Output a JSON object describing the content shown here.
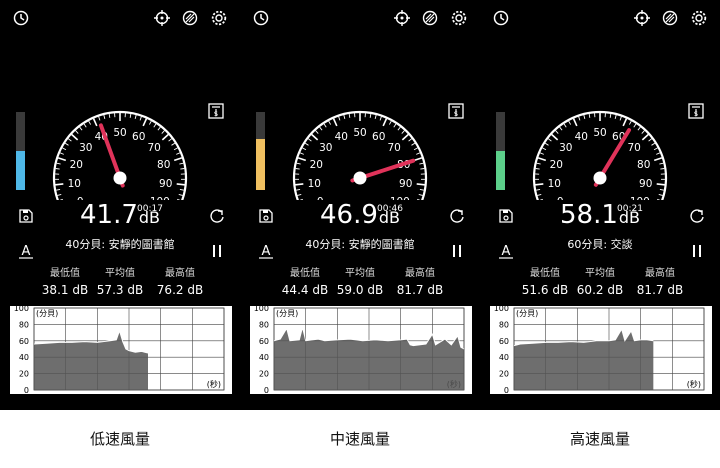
{
  "panels": [
    {
      "value": "41.7",
      "unit": "dB",
      "time": [
        "00",
        "17"
      ],
      "description": "40分貝: 安靜的圖書館",
      "stats": {
        "min_label": "最低值",
        "min": "38.1 dB",
        "avg_label": "平均值",
        "avg": "57.3 dB",
        "max_label": "最高值",
        "max": "76.2 dB"
      },
      "needle": 41.7,
      "level_fraction": 0.5,
      "level_color": "#4fb8e8",
      "caption": "低速風量",
      "chart_series": [
        [
          0,
          56
        ],
        [
          2,
          57
        ],
        [
          4,
          58
        ],
        [
          6,
          58
        ],
        [
          8,
          59
        ],
        [
          10,
          58
        ],
        [
          12,
          60
        ],
        [
          13,
          61
        ],
        [
          13.5,
          72
        ],
        [
          14,
          59
        ],
        [
          14.5,
          50
        ],
        [
          15,
          48
        ],
        [
          16,
          46
        ],
        [
          17,
          47
        ],
        [
          17.5,
          46
        ],
        [
          18,
          45
        ]
      ],
      "chart_end": 18
    },
    {
      "value": "46.9",
      "unit": "dB",
      "time": [
        "00",
        "46"
      ],
      "description": "40分貝: 安靜的圖書館",
      "stats": {
        "min_label": "最低值",
        "min": "44.4 dB",
        "avg_label": "平均值",
        "avg": "59.0 dB",
        "max_label": "最高值",
        "max": "81.7 dB"
      },
      "needle": 80,
      "level_fraction": 0.65,
      "level_color": "#f0c060",
      "caption": "中速風量",
      "chart_series": [
        [
          0,
          60
        ],
        [
          1,
          62
        ],
        [
          2,
          75
        ],
        [
          2.5,
          60
        ],
        [
          4,
          61
        ],
        [
          4.5,
          76
        ],
        [
          5,
          60
        ],
        [
          7,
          62
        ],
        [
          8,
          60
        ],
        [
          10,
          61
        ],
        [
          12,
          62
        ],
        [
          14,
          60
        ],
        [
          16,
          61
        ],
        [
          18,
          60
        ],
        [
          20,
          61
        ],
        [
          21,
          62
        ],
        [
          21.5,
          55
        ],
        [
          22,
          54
        ],
        [
          24,
          56
        ],
        [
          25,
          68
        ],
        [
          25.5,
          55
        ],
        [
          27,
          62
        ],
        [
          28,
          55
        ],
        [
          29,
          66
        ],
        [
          29.5,
          52
        ],
        [
          30,
          50
        ]
      ],
      "chart_end": 30
    },
    {
      "value": "58.1",
      "unit": "dB",
      "time": [
        "00",
        "21"
      ],
      "description": "60分貝: 交談",
      "stats": {
        "min_label": "最低值",
        "min": "51.6 dB",
        "avg_label": "平均值",
        "avg": "60.2 dB",
        "max_label": "最高值",
        "max": "81.7 dB"
      },
      "needle": 63,
      "level_fraction": 0.5,
      "level_color": "#5ccf8a",
      "caption": "高速風量",
      "chart_series": [
        [
          0,
          54
        ],
        [
          1,
          56
        ],
        [
          3,
          57
        ],
        [
          5,
          58
        ],
        [
          7,
          58
        ],
        [
          9,
          59
        ],
        [
          11,
          58
        ],
        [
          13,
          60
        ],
        [
          15,
          60
        ],
        [
          16,
          61
        ],
        [
          17,
          74
        ],
        [
          17.5,
          60
        ],
        [
          18.5,
          72
        ],
        [
          19,
          60
        ],
        [
          20,
          61
        ],
        [
          21,
          61
        ],
        [
          22,
          60
        ]
      ],
      "chart_end": 22
    }
  ],
  "gauge_ticks": [
    "0",
    "10",
    "20",
    "30",
    "40",
    "50",
    "60",
    "70",
    "80",
    "90",
    "100"
  ],
  "chart_axis": {
    "y_ticks": [
      "100",
      "80",
      "60",
      "40",
      "20",
      "0"
    ],
    "y_label": "(分貝)",
    "x_ticks": [
      "0",
      "5",
      "10",
      "15",
      "20",
      "25",
      "30"
    ],
    "x_label": "(秒)"
  },
  "icons": [
    "history-icon",
    "crosshair-icon",
    "tile-icon",
    "gear-icon",
    "save-icon",
    "reset-icon",
    "text-a-icon",
    "pause-icon",
    "export-icon"
  ],
  "colors": {
    "needle": "#e0335a",
    "hub": "#ffffff"
  }
}
